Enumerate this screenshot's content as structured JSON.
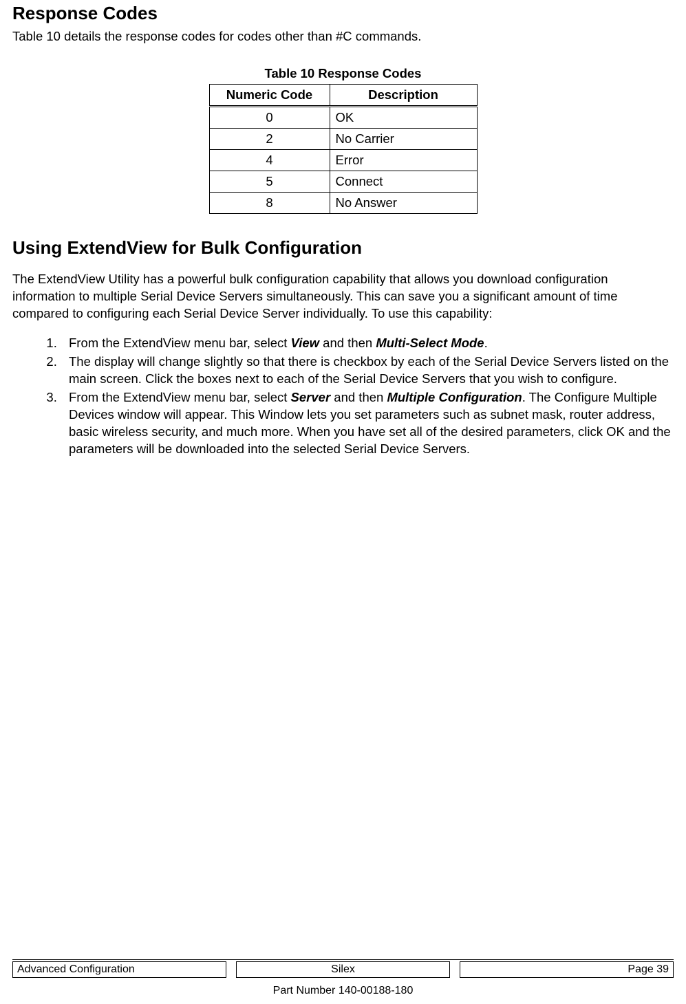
{
  "section1": {
    "title": "Response Codes",
    "intro": "Table 10 details the response codes for codes other than #C commands."
  },
  "table": {
    "caption": "Table 10  Response Codes",
    "headers": {
      "code": "Numeric Code",
      "desc": "Description"
    },
    "rows": [
      {
        "code": "0",
        "desc": "OK"
      },
      {
        "code": "2",
        "desc": "No Carrier"
      },
      {
        "code": "4",
        "desc": "Error"
      },
      {
        "code": "5",
        "desc": "Connect"
      },
      {
        "code": "8",
        "desc": "No Answer"
      }
    ]
  },
  "section2": {
    "title": "Using ExtendView for Bulk Configuration",
    "body": "The ExtendView Utility has a powerful bulk configuration capability that allows you download configuration information to multiple Serial Device Servers simultaneously.  This can save you a significant amount of time compared to configuring each Serial Device Server individually.  To use this capability:"
  },
  "steps": {
    "s1a": "From the ExtendView menu bar, select ",
    "s1b": "View",
    "s1c": " and then ",
    "s1d": "Multi-Select Mode",
    "s1e": ".",
    "s2": "The display will change slightly so that there is checkbox by each of the Serial Device Servers listed on the main screen.  Click the boxes next to each of the Serial Device Servers that you wish to configure.",
    "s3a": "From the ExtendView menu bar, select ",
    "s3b": "Server",
    "s3c": " and then ",
    "s3d": "Multiple Configuration",
    "s3e": ".  The Configure Multiple Devices window will appear.  This Window lets you set parameters such as subnet mask, router address, basic wireless security, and much more.  When you have set all of the desired parameters, click OK and the parameters will be downloaded into the selected Serial Device Servers."
  },
  "footer": {
    "left": "Advanced Configuration",
    "center": "Silex",
    "right": "Page 39",
    "part": "Part Number 140-00188-180"
  }
}
